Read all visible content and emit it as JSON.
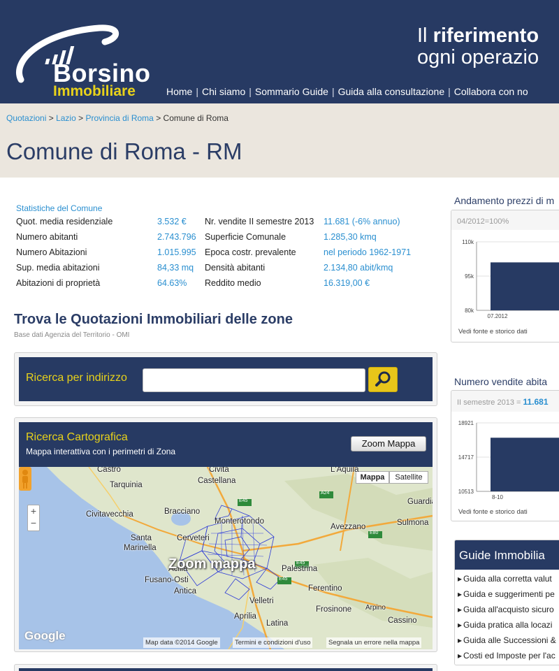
{
  "header": {
    "logo": {
      "word1": "Borsino",
      "word2": "Immobiliare"
    },
    "tagline": {
      "line1_prefix": "Il ",
      "line1_bold": "riferimento",
      "line2": "ogni operazio"
    },
    "nav": [
      "Home",
      "Chi siamo",
      "Sommario Guide",
      "Guida alla consultazione",
      "Collabora con no"
    ]
  },
  "breadcrumb": {
    "items": [
      "Quotazioni",
      "Lazio",
      "Provincia di Roma"
    ],
    "current": "Comune di Roma",
    "separator": ">"
  },
  "page_title": "Comune di Roma - RM",
  "stats": {
    "title": "Statistiche del Comune",
    "left": [
      {
        "label": "Quot. media residenziale",
        "value": "3.532 €"
      },
      {
        "label": "Numero abitanti",
        "value": "2.743.796"
      },
      {
        "label": "Numero Abitazioni",
        "value": "1.015.995"
      },
      {
        "label": "Sup. media abitazioni",
        "value": "84,33 mq"
      },
      {
        "label": "Abitazioni di proprietà",
        "value": "64.63%"
      }
    ],
    "right": [
      {
        "label": "Nr. vendite II semestre 2013",
        "value": "11.681 (-6% annuo)"
      },
      {
        "label": "Superficie Comunale",
        "value": "1.285,30 kmq"
      },
      {
        "label": "Epoca costr. prevalente",
        "value": "nel periodo 1962-1971"
      },
      {
        "label": "Densità abitanti",
        "value": "2.134,80 abit/kmq"
      },
      {
        "label": "Reddito medio",
        "value": "16.319,00 €"
      }
    ]
  },
  "quotazioni": {
    "title": "Trova le Quotazioni Immobiliari delle zone",
    "subtitle": "Base dati Agenzia del Territorio - OMI"
  },
  "address_search": {
    "label": "Ricerca per indirizzo",
    "value": "",
    "placeholder": ""
  },
  "map_search": {
    "title": "Ricerca Cartografica",
    "subtitle": "Mappa interattiva con i perimetri di Zona",
    "zoom_button": "Zoom Mappa",
    "map_types": [
      "Mappa",
      "Satellite"
    ],
    "overlay_text": "Zoom mappa",
    "google_logo": "Google",
    "footer": [
      "Map data ©2014 Google",
      "Termini e condizioni d'uso",
      "Segnala un errore nella mappa"
    ],
    "zoom_in": "+",
    "zoom_out": "−",
    "places": [
      "Castro",
      "Civita",
      "Castellana",
      "L'Aquila",
      "Tarquinia",
      "Guardia",
      "Civitavecchia",
      "Bracciano",
      "Sulmona",
      "Monterotondo",
      "Avezzano",
      "Santa",
      "Marinella",
      "Cerveteri",
      "Acilia",
      "Palestrina",
      "Fusano-Osti",
      "Antica",
      "Ferentino",
      "Velletri",
      "Frosinone",
      "Arpino",
      "Aprilia",
      "Latina",
      "Cassino"
    ],
    "road_shields": [
      "E45",
      "A24",
      "E45",
      "E80",
      "E45"
    ]
  },
  "price_chart": {
    "title": "Andamento prezzi di m",
    "base_note": "04/2012=100%",
    "y_ticks": [
      "110k",
      "95k",
      "80k"
    ],
    "x_ticks": [
      "07.2012"
    ],
    "link": "Vedi fonte e storico dati",
    "chart_data": {
      "type": "area",
      "x": [
        "07.2012"
      ],
      "series": [
        {
          "values": [
            101000
          ]
        }
      ],
      "ylim": [
        80000,
        110000
      ]
    }
  },
  "sales_chart": {
    "title": "Numero vendite abita",
    "note_prefix": "II semestre 2013 = ",
    "note_value": "11.681",
    "y_ticks": [
      "18921",
      "14717",
      "10513"
    ],
    "x_ticks": [
      "8-10"
    ],
    "link": "Vedi fonte e storico dati",
    "chart_data": {
      "type": "area",
      "x": [
        "8-10"
      ],
      "series": [
        {
          "values": [
            17100
          ]
        }
      ],
      "ylim": [
        10513,
        18921
      ]
    }
  },
  "guides": {
    "title": "Guide Immobilia",
    "items": [
      "Guida alla corretta valut",
      "Guida e suggerimenti pe",
      "Guida all'acquisto sicuro",
      "Guida pratica alla locazi",
      "Guida alle Successioni &",
      "Costi ed Imposte per l'ac"
    ]
  },
  "colors": {
    "header_bg": "#273a63",
    "accent_yellow": "#e8d21a",
    "link_blue": "#2a8fd0",
    "band_bg": "#ebe6de"
  }
}
